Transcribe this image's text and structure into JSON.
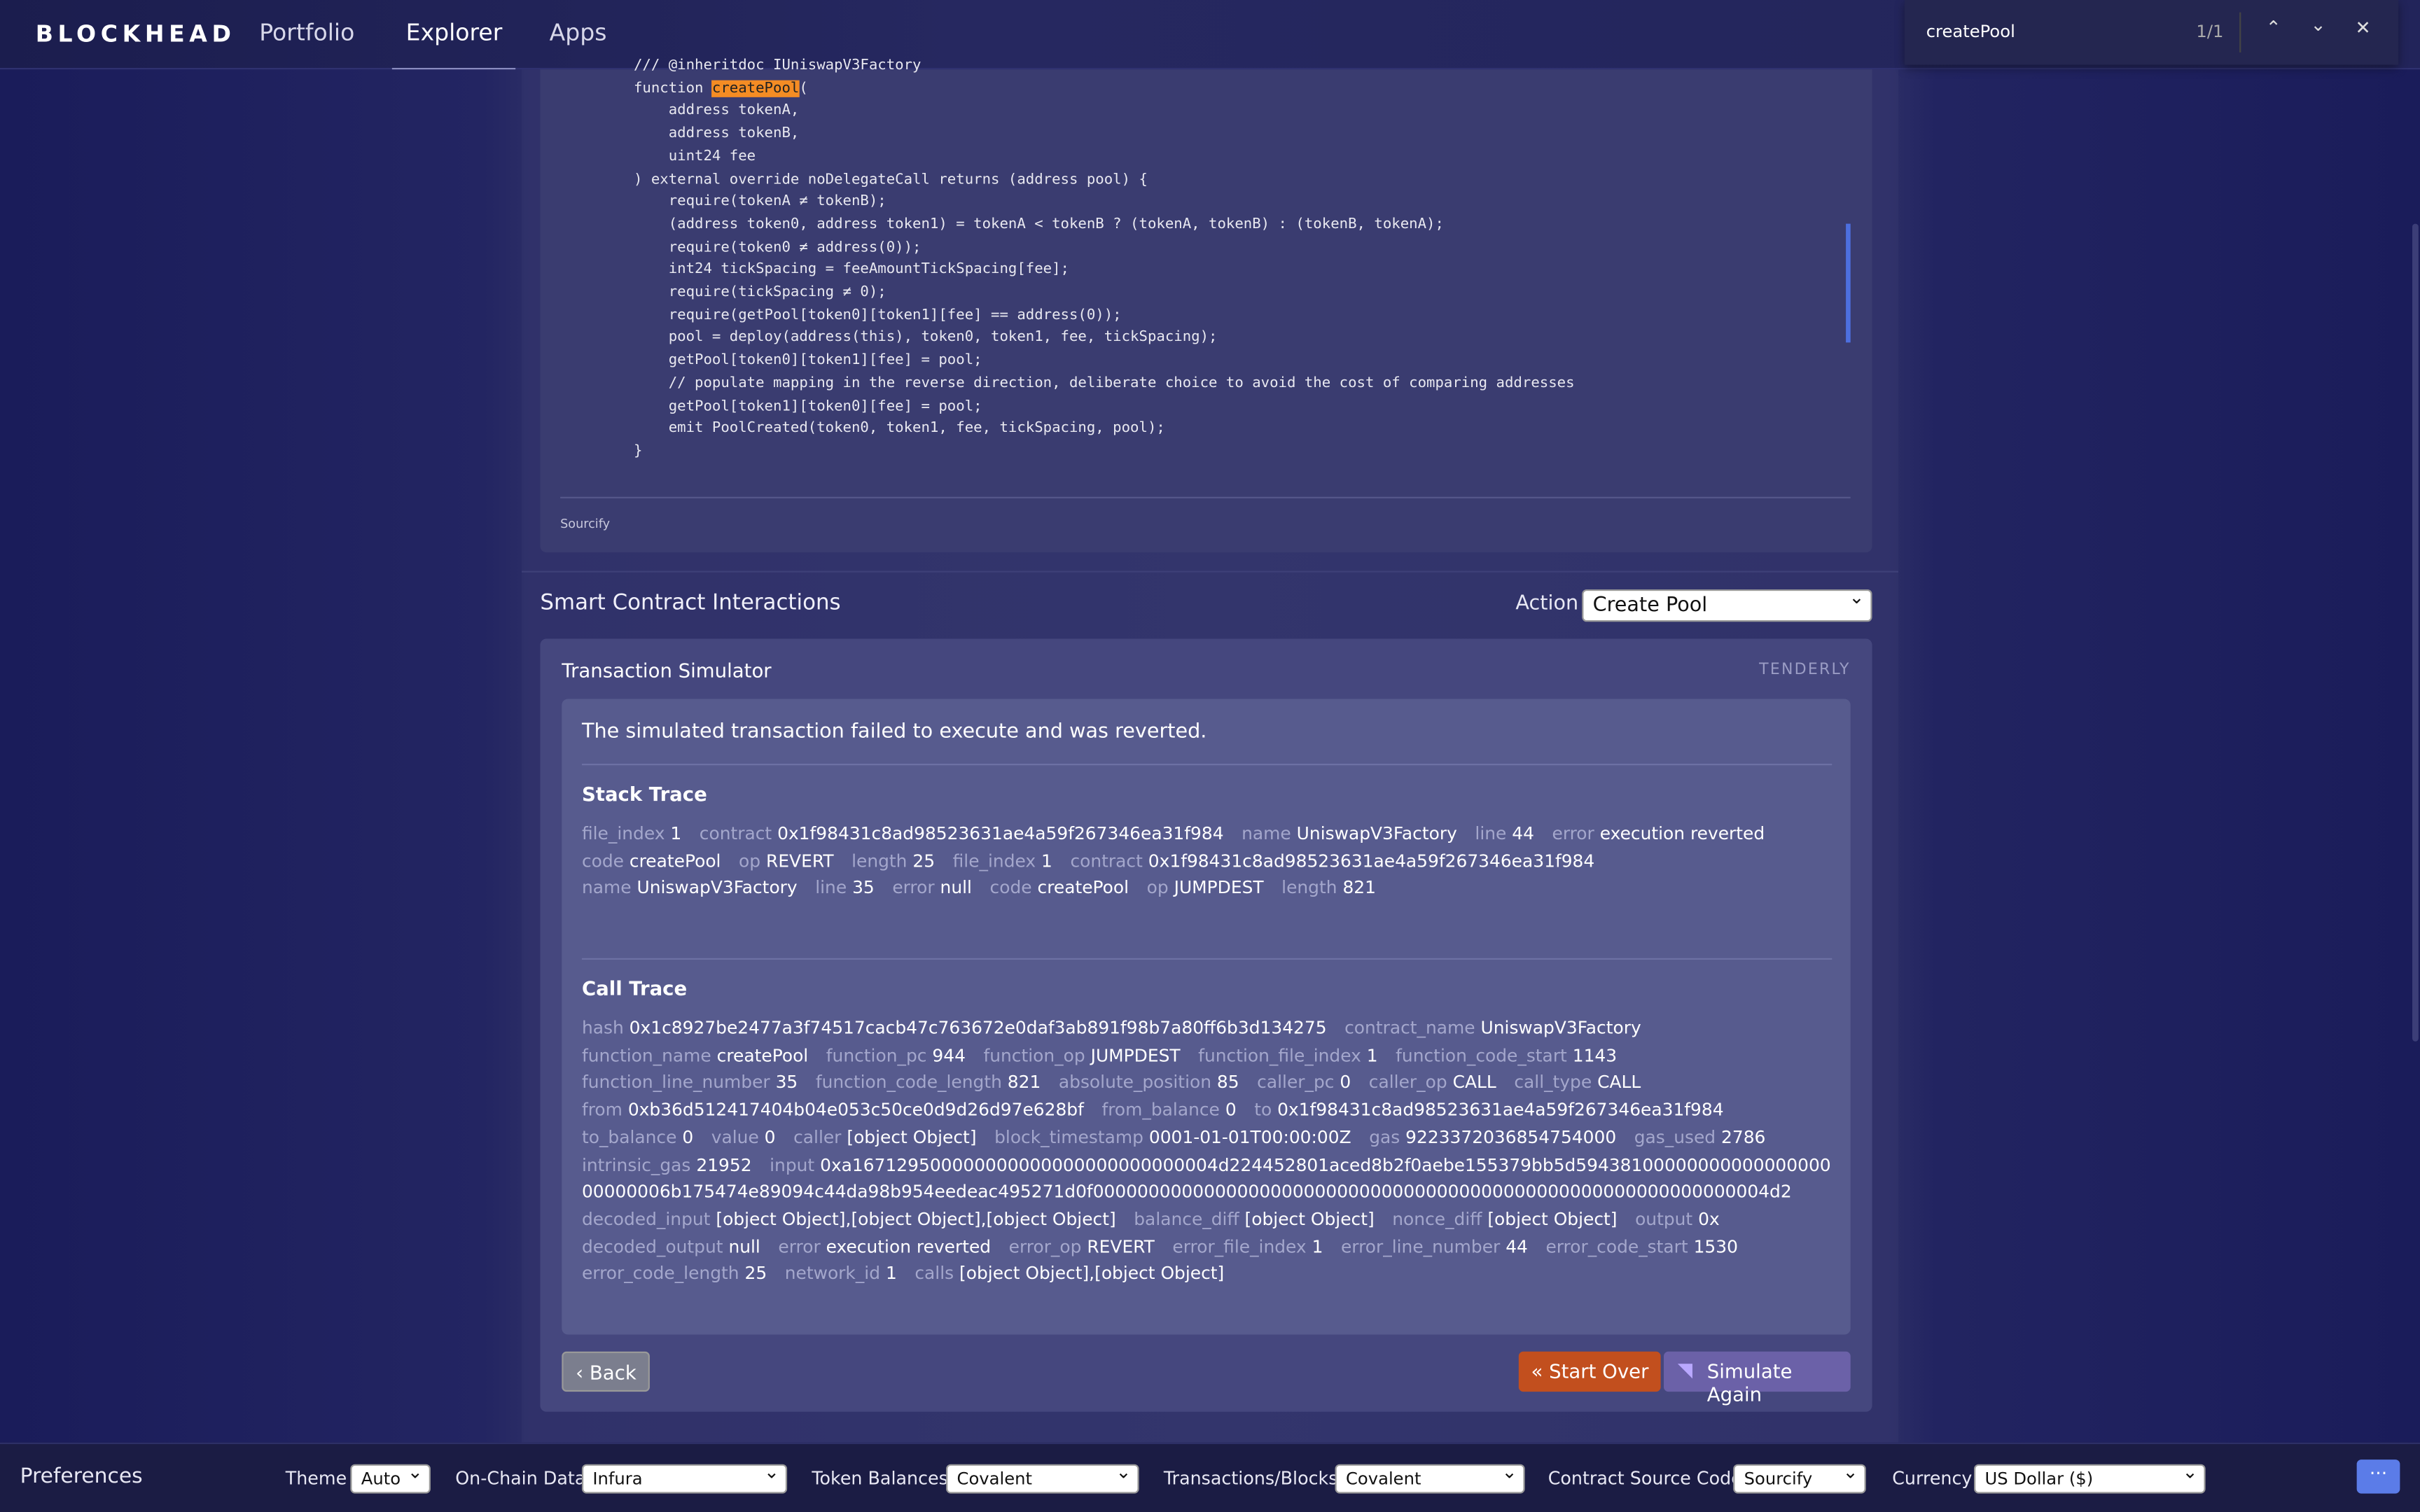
{
  "nav": {
    "logo": "BLOCKHEAD",
    "links": [
      "Portfolio",
      "Explorer",
      "Apps"
    ],
    "active": "Explorer"
  },
  "find": {
    "query": "createPool",
    "count": "1/1"
  },
  "code": {
    "before": "    /// @inheritdoc IUniswapV3Factory\n    function ",
    "match": "createPool",
    "after": "(\n        address tokenA,\n        address tokenB,\n        uint24 fee\n    ) external override noDelegateCall returns (address pool) {\n        require(tokenA ≠ tokenB);\n        (address token0, address token1) = tokenA < tokenB ? (tokenA, tokenB) : (tokenB, tokenA);\n        require(token0 ≠ address(0));\n        int24 tickSpacing = feeAmountTickSpacing[fee];\n        require(tickSpacing ≠ 0);\n        require(getPool[token0][token1][fee] == address(0));\n        pool = deploy(address(this), token0, token1, fee, tickSpacing);\n        getPool[token0][token1][fee] = pool;\n        // populate mapping in the reverse direction, deliberate choice to avoid the cost of comparing addresses\n        getPool[token1][token0][fee] = pool;\n        emit PoolCreated(token0, token1, fee, tickSpacing, pool);\n    }",
    "source": "Sourcify"
  },
  "interactions": {
    "title": "Smart Contract Interactions",
    "action_label": "Action",
    "action_value": "Create Pool"
  },
  "simulator": {
    "title": "Transaction Simulator",
    "provider": "TENDERLY",
    "message": "The simulated transaction failed to execute and was reverted.",
    "stack_title": "Stack Trace",
    "stack": [
      [
        "file_index",
        "1"
      ],
      [
        "contract",
        "0x1f98431c8ad98523631ae4a59f267346ea31f984"
      ],
      [
        "name",
        "UniswapV3Factory"
      ],
      [
        "line",
        "44"
      ],
      [
        "error",
        "execution reverted"
      ],
      [
        "code",
        "createPool"
      ],
      [
        "op",
        "REVERT"
      ],
      [
        "length",
        "25"
      ],
      [
        "file_index",
        "1"
      ],
      [
        "contract",
        "0x1f98431c8ad98523631ae4a59f267346ea31f984"
      ],
      [
        "name",
        "UniswapV3Factory"
      ],
      [
        "line",
        "35"
      ],
      [
        "error",
        "null"
      ],
      [
        "code",
        "createPool"
      ],
      [
        "op",
        "JUMPDEST"
      ],
      [
        "length",
        "821"
      ]
    ],
    "call_title": "Call Trace",
    "call": [
      [
        "hash",
        "0x1c8927be2477a3f74517cacb47c763672e0daf3ab891f98b7a80ff6b3d134275"
      ],
      [
        "contract_name",
        "UniswapV3Factory"
      ],
      [
        "function_name",
        "createPool"
      ],
      [
        "function_pc",
        "944"
      ],
      [
        "function_op",
        "JUMPDEST"
      ],
      [
        "function_file_index",
        "1"
      ],
      [
        "function_code_start",
        "1143"
      ],
      [
        "function_line_number",
        "35"
      ],
      [
        "function_code_length",
        "821"
      ],
      [
        "absolute_position",
        "85"
      ],
      [
        "caller_pc",
        "0"
      ],
      [
        "caller_op",
        "CALL"
      ],
      [
        "call_type",
        "CALL"
      ],
      [
        "from",
        "0xb36d512417404b04e053c50ce0d9d26d97e628bf"
      ],
      [
        "from_balance",
        "0"
      ],
      [
        "to",
        "0x1f98431c8ad98523631ae4a59f267346ea31f984"
      ],
      [
        "to_balance",
        "0"
      ],
      [
        "value",
        "0"
      ],
      [
        "caller",
        "[object Object]"
      ],
      [
        "block_timestamp",
        "0001-01-01T00:00:00Z"
      ],
      [
        "gas",
        "9223372036854754000"
      ],
      [
        "gas_used",
        "2786"
      ],
      [
        "intrinsic_gas",
        "21952"
      ],
      [
        "input",
        "0xa167129500000000000000000000000004d224452801aced8b2f0aebe155379bb5d5943810000000000000000000000006b175474e89094c44da98b954eedeac495271d0f0000000000000000000000000000000000000000000000000000000000004d2"
      ],
      [
        "decoded_input",
        "[object Object],[object Object],[object Object]"
      ],
      [
        "balance_diff",
        "[object Object]"
      ],
      [
        "nonce_diff",
        "[object Object]"
      ],
      [
        "output",
        "0x"
      ],
      [
        "decoded_output",
        "null"
      ],
      [
        "error",
        "execution reverted"
      ],
      [
        "error_op",
        "REVERT"
      ],
      [
        "error_file_index",
        "1"
      ],
      [
        "error_line_number",
        "44"
      ],
      [
        "error_code_start",
        "1530"
      ],
      [
        "error_code_length",
        "25"
      ],
      [
        "network_id",
        "1"
      ],
      [
        "calls",
        "[object Object],[object Object]"
      ]
    ],
    "back": "‹ Back",
    "start_over": "« Start Over",
    "simulate_again": "Simulate Again"
  },
  "prefs": {
    "title": "Preferences",
    "items": [
      {
        "label": "Theme",
        "value": "Auto"
      },
      {
        "label": "On-Chain Data",
        "value": "Infura"
      },
      {
        "label": "Token Balances",
        "value": "Covalent"
      },
      {
        "label": "Transactions/Blocks",
        "value": "Covalent"
      },
      {
        "label": "Contract Source Code",
        "value": "Sourcify"
      },
      {
        "label": "Currency",
        "value": "US Dollar ($)"
      }
    ],
    "menu": "···"
  }
}
